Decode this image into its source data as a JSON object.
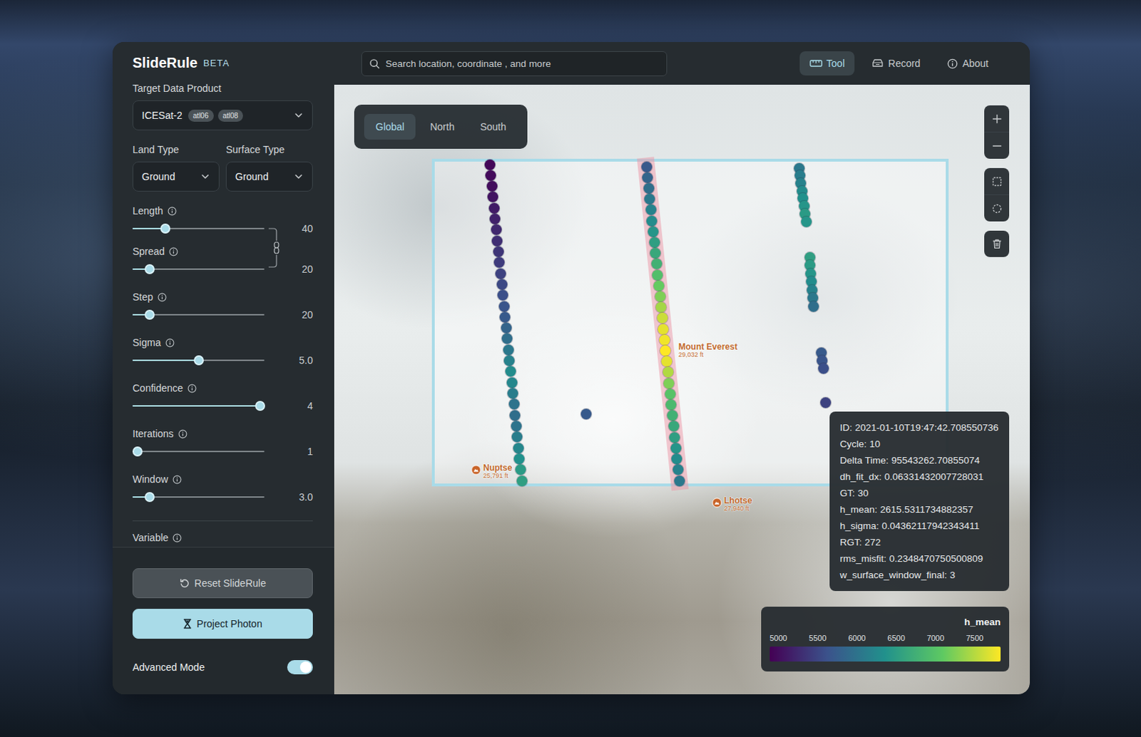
{
  "app": {
    "title": "SlideRule",
    "badge": "BETA"
  },
  "search": {
    "placeholder": "Search location, coordinate , and more"
  },
  "nav": [
    {
      "label": "Tool",
      "selected": true
    },
    {
      "label": "Record",
      "selected": false
    },
    {
      "label": "About",
      "selected": false
    }
  ],
  "sidebar": {
    "product": {
      "label": "Target Data Product",
      "value": "ICESat-2",
      "tags": [
        "atl06",
        "atl08"
      ]
    },
    "selects": [
      {
        "label": "Land Type",
        "value": "Ground"
      },
      {
        "label": "Surface Type",
        "value": "Ground"
      }
    ],
    "sliders": [
      {
        "label": "Length",
        "level": 0.25,
        "reading": "40",
        "linked": true
      },
      {
        "label": "Spread",
        "level": 0.13,
        "reading": "20",
        "linked": true
      },
      {
        "label": "Step",
        "level": 0.13,
        "reading": "20",
        "linked": false
      },
      {
        "label": "Sigma",
        "level": 0.5,
        "reading": "5.0",
        "linked": false
      },
      {
        "label": "Confidence",
        "level": 0.97,
        "reading": "4",
        "linked": false
      },
      {
        "label": "Iterations",
        "level": 0.04,
        "reading": "1",
        "linked": false
      },
      {
        "label": "Window",
        "level": 0.13,
        "reading": "3.0",
        "linked": false
      }
    ],
    "next_section": "Variable",
    "reset_button": "Reset SlideRule",
    "project_button": "Project Photon",
    "advanced_mode": {
      "label": "Advanced Mode",
      "on": true
    }
  },
  "map": {
    "regions": [
      {
        "label": "Global",
        "selected": true
      },
      {
        "label": "North",
        "selected": false
      },
      {
        "label": "South",
        "selected": false
      }
    ],
    "labels": [
      {
        "name": "Mount Everest",
        "elevation": "29,032 ft",
        "pin": false
      },
      {
        "name": "Lhotse",
        "elevation": "27,940 ft",
        "pin": true
      },
      {
        "name": "Nuptse",
        "elevation": "25,791 ft",
        "pin": true
      }
    ],
    "tracks": [
      {
        "values": [
          5050,
          5080,
          5100,
          5150,
          5200,
          5250,
          5300,
          5350,
          5400,
          5450,
          5500,
          5550,
          5600,
          5650,
          5700,
          5800,
          5900,
          6000,
          6100,
          6200,
          6150,
          6050,
          5950,
          5900,
          5950,
          6050,
          6150,
          6250,
          6350,
          6400
        ],
        "selected": false
      },
      {
        "values": [
          5700,
          5800,
          5900,
          6000,
          6100,
          6200,
          6300,
          6400,
          6500,
          6600,
          6750,
          6900,
          7000,
          7150,
          7300,
          7400,
          7450,
          7500,
          7400,
          7200,
          7000,
          6800,
          6700,
          6600,
          6500,
          6400,
          6300,
          6200,
          6100,
          6000
        ],
        "selected": true
      },
      {
        "values": [
          6000,
          6050,
          6100,
          6200,
          6250,
          6300,
          6350,
          6300
        ],
        "selected": false
      },
      {
        "values": [
          6400,
          6350,
          6300,
          6200,
          6100,
          6000,
          5900
        ],
        "selected": false
      },
      {
        "values": [
          5700,
          5650,
          5600
        ],
        "selected": false
      },
      {
        "values": [
          5700
        ],
        "selected": false
      },
      {
        "values": [
          5500
        ],
        "selected": false
      }
    ],
    "tooltip": [
      {
        "label": "ID:",
        "value": "2021-01-10T19:47:42.708550736"
      },
      {
        "label": "Cycle:",
        "value": "10"
      },
      {
        "label": "Delta Time:",
        "value": "95543262.70855074"
      },
      {
        "label": "dh_fit_dx:",
        "value": "0.06331432007728031"
      },
      {
        "label": "GT:",
        "value": "30"
      },
      {
        "label": "h_mean:",
        "value": "2615.5311734882357"
      },
      {
        "label": "h_sigma:",
        "value": "0.04362117942343411"
      },
      {
        "label": "RGT:",
        "value": "272"
      },
      {
        "label": "rms_misfit:",
        "value": "0.2348470750500809"
      },
      {
        "label": "w_surface_window_final:",
        "value": "3"
      }
    ],
    "legend": {
      "title": "h_mean",
      "ticks": [
        "5000",
        "5500",
        "6000",
        "6500",
        "7000",
        "7500"
      ]
    }
  }
}
